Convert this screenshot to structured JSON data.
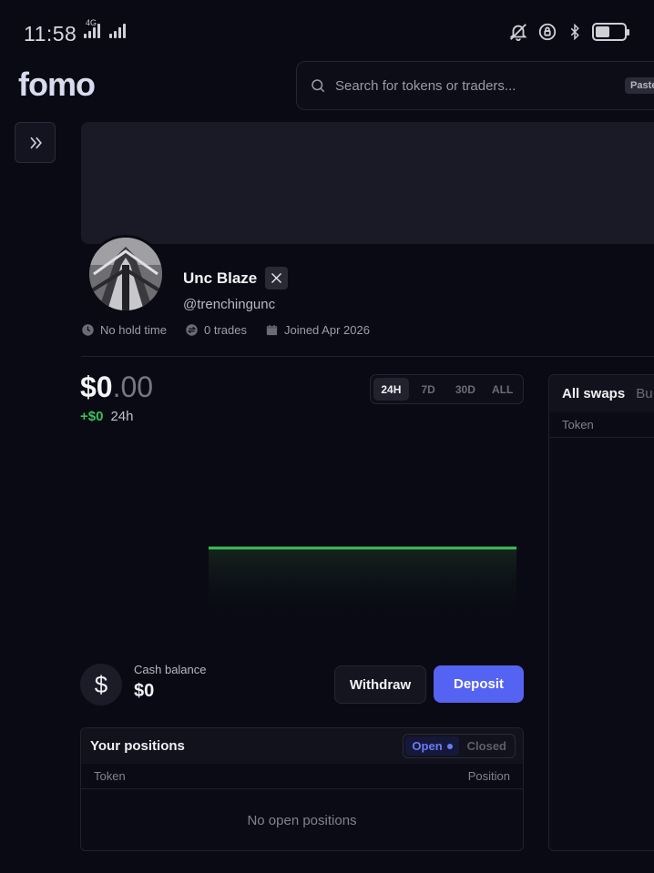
{
  "status_bar": {
    "time": "11:58",
    "network": "4G"
  },
  "header": {
    "logo": "fomo",
    "search_placeholder": "Search for tokens or traders...",
    "paste_label": "Paste"
  },
  "profile": {
    "name": "Unc Blaze",
    "handle": "@trenchingunc",
    "hold_time": "No hold time",
    "trades": "0 trades",
    "joined": "Joined Apr 2026"
  },
  "portfolio": {
    "balance_whole": "$0",
    "balance_decimal": ".00",
    "change_value": "+$0",
    "change_period": "24h",
    "ranges": [
      "24H",
      "7D",
      "30D",
      "ALL"
    ],
    "active_range": "24H",
    "chart_color": "#3bc15a"
  },
  "cash": {
    "icon_symbol": "$",
    "label": "Cash balance",
    "value": "$0",
    "withdraw_label": "Withdraw",
    "deposit_label": "Deposit"
  },
  "positions": {
    "title": "Your positions",
    "tab_open": "Open",
    "tab_closed": "Closed",
    "col_token": "Token",
    "col_position": "Position",
    "empty_text": "No open positions"
  },
  "swaps": {
    "tab_all": "All swaps",
    "tab_next": "Bu",
    "col_token": "Token"
  },
  "colors": {
    "accent": "#5563f2",
    "positive": "#3bc15a",
    "background": "#0a0a14"
  }
}
